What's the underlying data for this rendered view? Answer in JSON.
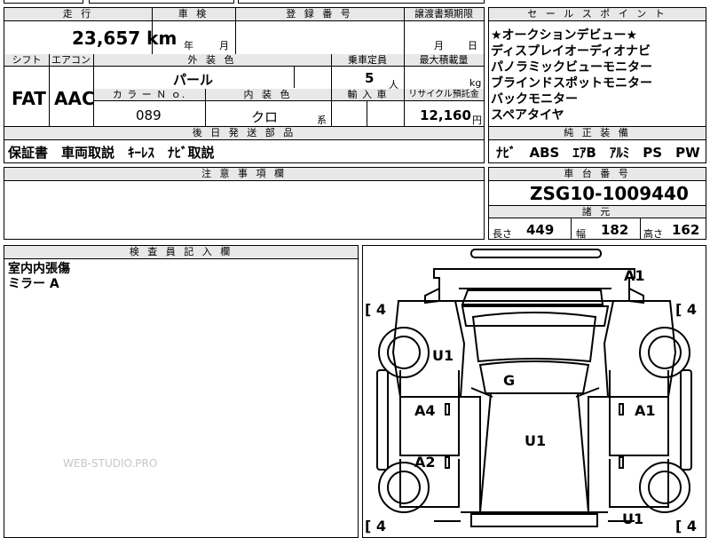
{
  "mileage": {
    "label": "走 行",
    "value": "23,657",
    "unit": "km"
  },
  "inspection": {
    "label": "車 検",
    "year_unit": "年",
    "month_unit": "月"
  },
  "registration": {
    "label": "登 録 番 号"
  },
  "transfer_deadline": {
    "label": "譲渡書類期限",
    "month_unit": "月",
    "day_unit": "日"
  },
  "row2_headers": {
    "shift": "シフト",
    "aircon": "エアコン",
    "exterior_color": "外 装 色",
    "capacity": "乗車定員",
    "max_load": "最大積載量"
  },
  "shift": "FAT",
  "aircon": "AAC",
  "exterior_color": "パール",
  "capacity": {
    "value": "5",
    "unit": "人"
  },
  "max_load_unit": "kg",
  "row3_headers": {
    "color_no": "カ ラ ー Ｎ ｏ.",
    "interior_color": "内 装 色",
    "import": "輸 入 車",
    "recycle": "リサイクル預託金"
  },
  "color_no": "089",
  "interior": {
    "value": "クロ",
    "unit": "系"
  },
  "recycle": {
    "value": "12,160",
    "unit": "円"
  },
  "sales_point": {
    "label": "セ ー ル ス ポ イ ン ト",
    "items": [
      "★オークションデビュー★",
      "ディスプレイオーディオナビ",
      "パノラミックビューモニター",
      "ブラインドスポットモニター",
      "バックモニター",
      "スペアタイヤ"
    ]
  },
  "later_parts": {
    "label": "後 日 発 送 部 品",
    "value": "保証書　車両取説　ｷｰﾚｽ　ﾅﾋﾞ取説"
  },
  "genuine_equipment": {
    "label": "純 正 装 備",
    "value": "ﾅﾋﾞ　ABS　ｴｱB　ｱﾙﾐ　PS　PW"
  },
  "notes": {
    "label": "注 意 事 項 欄"
  },
  "chassis": {
    "label": "車 台 番 号",
    "value": "ZSG10-1009440"
  },
  "specs": {
    "label": "諸 元",
    "length_label": "長さ",
    "length": "449",
    "width_label": "幅",
    "width": "182",
    "height_label": "高さ",
    "height": "162"
  },
  "inspector": {
    "label": "検 査 員 記 入 欄",
    "lines": [
      "室内内張傷",
      "ミラー A"
    ]
  },
  "watermark": "WEB-STUDIO.PRO",
  "diagram_marks": {
    "bracket_tl": "[ 4",
    "bracket_tr": "[ 4",
    "bracket_bl": "[ 4",
    "bracket_br": "[ 4",
    "a1_top": "A1",
    "u1_left": "U1",
    "g": "G",
    "a4": "A4",
    "a1_right": "A1",
    "u1_center": "U1",
    "a2": "A2",
    "u1_bottom": "U1"
  }
}
